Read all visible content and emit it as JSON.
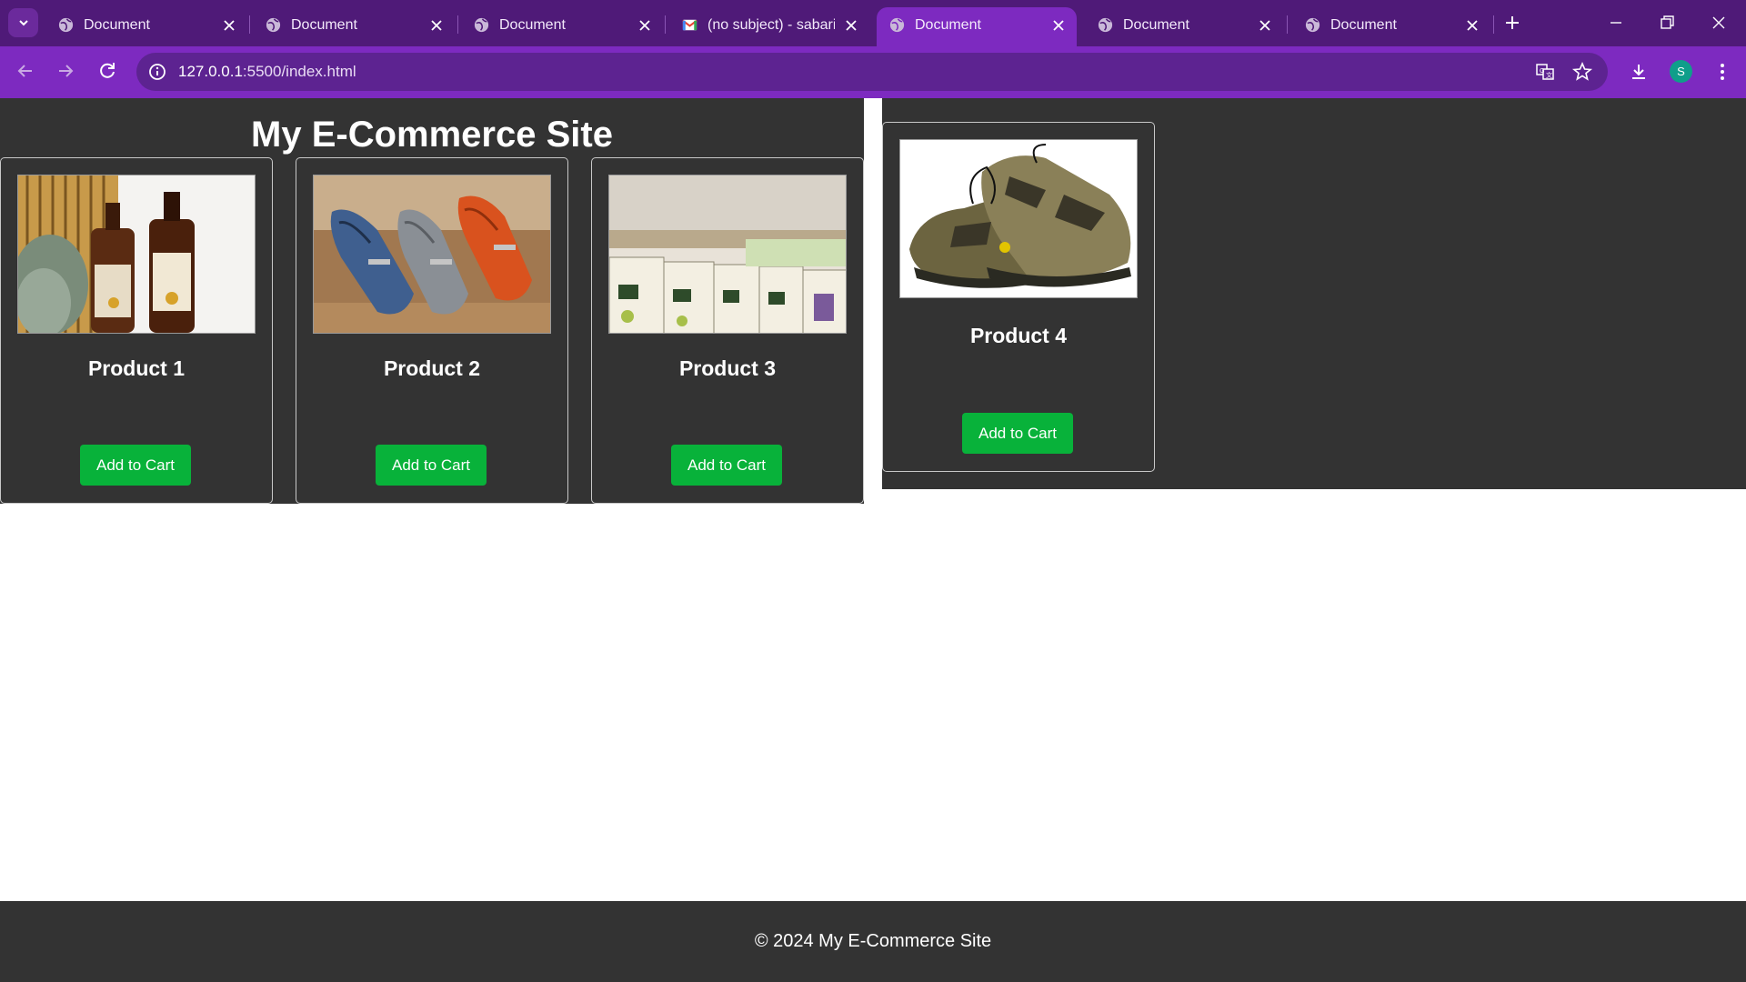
{
  "browser": {
    "tabs": [
      {
        "title": "Document",
        "active": false,
        "favicon": "globe-icon"
      },
      {
        "title": "Document",
        "active": false,
        "favicon": "globe-icon"
      },
      {
        "title": "Document",
        "active": false,
        "favicon": "globe-icon"
      },
      {
        "title": "(no subject) - sabarig",
        "active": false,
        "favicon": "gmail-icon"
      },
      {
        "title": "Document",
        "active": true,
        "favicon": "globe-icon"
      },
      {
        "title": "Document",
        "active": false,
        "favicon": "globe-icon"
      },
      {
        "title": "Document",
        "active": false,
        "favicon": "globe-icon"
      }
    ],
    "address": {
      "host": "127.0.0.1",
      "path": ":5500/index.html"
    },
    "profile_initial": "S",
    "colors": {
      "frame": "#4f1a78",
      "toolbar": "#7d2ac0",
      "omnibox": "#5d2391"
    }
  },
  "page": {
    "site_title": "My E-Commerce Site",
    "products": [
      {
        "name": "Product 1",
        "button": "Add to Cart",
        "image": "shampoo-bottles-image"
      },
      {
        "name": "Product 2",
        "button": "Add to Cart",
        "image": "loafer-shoes-image"
      },
      {
        "name": "Product 3",
        "button": "Add to Cart",
        "image": "soap-bars-image"
      },
      {
        "name": "Product 4",
        "button": "Add to Cart",
        "image": "hiking-shoes-image"
      }
    ],
    "footer": "© 2024 My E-Commerce Site",
    "colors": {
      "background": "#333333",
      "button": "#08b23a",
      "text": "#ffffff"
    }
  }
}
